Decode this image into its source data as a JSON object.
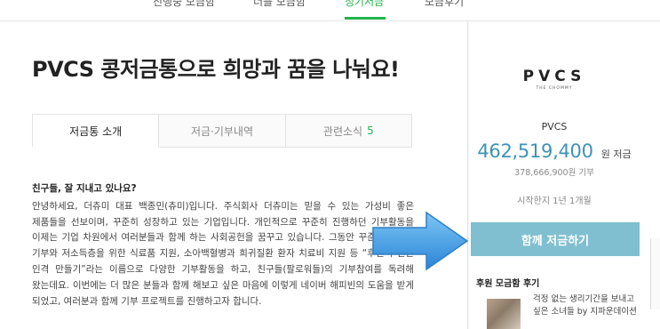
{
  "topnav": {
    "tabs": [
      {
        "label": "진행중 모금함"
      },
      {
        "label": "너를 모금함"
      },
      {
        "label": "정기저금"
      },
      {
        "label": "모금후기"
      }
    ]
  },
  "title": "PVCS 콩저금통으로 희망과 꿈을 나눠요!",
  "content_tabs": [
    {
      "label": "저금통 소개"
    },
    {
      "label": "저금·기부내역"
    },
    {
      "label": "관련소식",
      "count": "5"
    }
  ],
  "article": {
    "lead": "친구들, 잘 지내고 있나요?",
    "body": "안녕하세요, 더츄미 대표 백종민(츄미)입니다. 주식회사 더츄미는 믿을 수 있는 가성비 좋은 제품들을 선보이며, 꾸준히 성장하고 있는 기업입니다. 개인적으로 꾸준히 진행하던 기부활동을 이제는 기업 차원에서 여러분들과 함께 하는 사회공헌을 꿈꾸고 있습니다. 그동안 꾸준히 마스크 기부와 저소득층을 위한 식료품 지원, 소아백혈병과 희귀질환 환자 치료비 지원 등 “후천적 선한 인격 만들기”라는 이름으로 다양한 기부활동을 하고, 친구들(팔로워들)의 기부참여를 독려해 왔는데요. 이번에는 더 많은 분들과 함께 해보고 싶은 마음에 이렇게 네이버 해피빈의 도움을 받게 되었고, 여러분과 함께 기부 프로젝트를 진행하고자 합니다."
  },
  "side": {
    "logo_text": "PVCS",
    "logo_sub": "THE CHOMMY",
    "org_name": "PVCS",
    "amount": "462,519,400",
    "amount_unit": "원 저금",
    "donated": "378,666,900원 기부",
    "started": "시작한지 1년 1개월",
    "save_button": "함께 저금하기",
    "review_heading": "후원 모금함 후기",
    "review_text": "걱정 없는 생리기간을 보내고 싶은 소녀들 by 지파운데이션"
  },
  "colors": {
    "accent_green": "#1fb44b",
    "amount_blue": "#3e93b8",
    "button_teal": "#7fbfd0",
    "arrow_blue": "#3b9be0"
  }
}
